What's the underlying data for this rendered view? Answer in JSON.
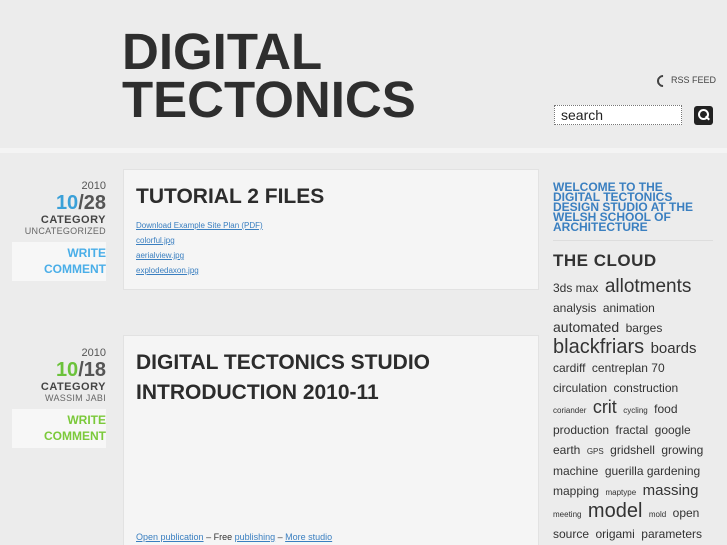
{
  "header": {
    "title_line1": "DIGITAL",
    "title_line2": "TECTONICS",
    "rss_label": "RSS FEED",
    "search_placeholder": "search"
  },
  "posts": [
    {
      "year": "2010",
      "month": "10",
      "day": "28",
      "sep": "/",
      "category_label": "CATEGORY",
      "category": "UNCATEGORIZED",
      "write1": "WRITE",
      "write2": "COMMENT",
      "title": "TUTORIAL 2 FILES",
      "links": [
        "Download Example Site Plan (PDF)",
        "colorful.jpg",
        "aerialview.jpg",
        "explodedaxon.jpg"
      ]
    },
    {
      "year": "2010",
      "month": "10",
      "day": "18",
      "sep": "/",
      "category_label": "CATEGORY",
      "category": "WASSIM JABI",
      "write1": "WRITE",
      "write2": "COMMENT",
      "title": "DIGITAL TECTONICS STUDIO INTRODUCTION 2010-11",
      "footer_link1": "Open publication",
      "footer_sep1": " – Free ",
      "footer_link2": "publishing",
      "footer_sep2": " – ",
      "footer_link3": "More studio"
    }
  ],
  "sidebar": {
    "welcome": "WELCOME TO THE DIGITAL TECTONICS DESIGN STUDIO AT THE WELSH SCHOOL OF ARCHITECTURE",
    "cloud_heading": "THE CLOUD",
    "tags": [
      {
        "text": "3ds max",
        "size": 12
      },
      {
        "text": "allotments",
        "size": 19
      },
      {
        "text": "analysis",
        "size": 12
      },
      {
        "text": "animation",
        "size": 12
      },
      {
        "text": "automated",
        "size": 14
      },
      {
        "text": "barges",
        "size": 12
      },
      {
        "text": "blackfriars",
        "size": 20
      },
      {
        "text": "boards",
        "size": 15
      },
      {
        "text": "cardiff",
        "size": 12
      },
      {
        "text": "centreplan 70",
        "size": 12
      },
      {
        "text": "circulation",
        "size": 12
      },
      {
        "text": "construction",
        "size": 12
      },
      {
        "text": "coriander",
        "size": 8
      },
      {
        "text": "crit",
        "size": 18
      },
      {
        "text": "cycling",
        "size": 8
      },
      {
        "text": "food",
        "size": 12
      },
      {
        "text": "production",
        "size": 12
      },
      {
        "text": "fractal",
        "size": 12
      },
      {
        "text": "google earth",
        "size": 12
      },
      {
        "text": "GPS",
        "size": 8
      },
      {
        "text": "gridshell",
        "size": 12
      },
      {
        "text": "growing",
        "size": 12
      },
      {
        "text": "machine",
        "size": 12
      },
      {
        "text": "guerilla gardening",
        "size": 12
      },
      {
        "text": "mapping",
        "size": 12
      },
      {
        "text": "maptype",
        "size": 8
      },
      {
        "text": "massing",
        "size": 15
      },
      {
        "text": "meeting",
        "size": 8
      },
      {
        "text": "model",
        "size": 20
      },
      {
        "text": "mold",
        "size": 8
      },
      {
        "text": "open source",
        "size": 12
      },
      {
        "text": "origami",
        "size": 12
      },
      {
        "text": "parameters",
        "size": 12
      }
    ]
  }
}
